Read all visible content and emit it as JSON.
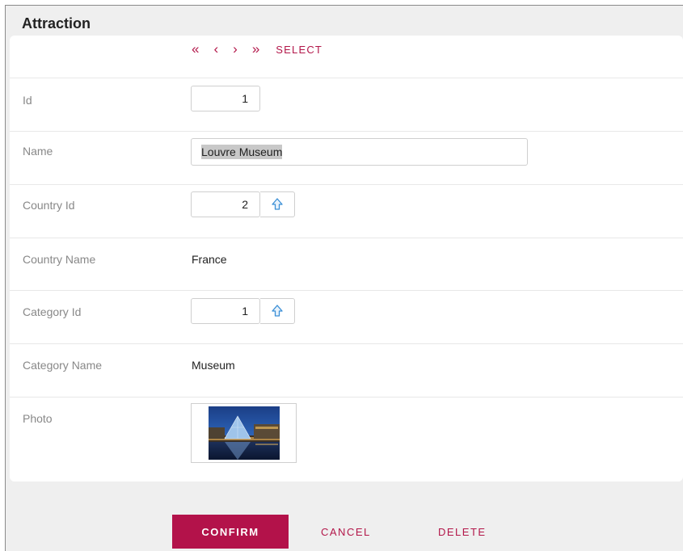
{
  "form": {
    "title": "Attraction",
    "nav": {
      "first": "«",
      "prev": "‹",
      "next": "›",
      "last": "»",
      "select_label": "SELECT"
    },
    "fields": {
      "id": {
        "label": "Id",
        "value": "1"
      },
      "name": {
        "label": "Name",
        "value": "Louvre Museum"
      },
      "country_id": {
        "label": "Country Id",
        "value": "2"
      },
      "country_name": {
        "label": "Country Name",
        "value": "France"
      },
      "category_id": {
        "label": "Category Id",
        "value": "1"
      },
      "category_name": {
        "label": "Category Name",
        "value": "Museum"
      },
      "photo": {
        "label": "Photo"
      }
    },
    "actions": {
      "confirm": "CONFIRM",
      "cancel": "CANCEL",
      "delete": "DELETE"
    }
  },
  "theme": {
    "accent": "#b3124a",
    "prompt_icon": "up-arrow-icon",
    "background": "#efefef"
  }
}
